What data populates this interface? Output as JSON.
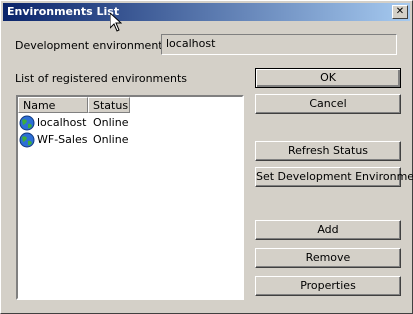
{
  "window": {
    "title": "Environments List",
    "close_glyph": "✕"
  },
  "dev_env": {
    "label": "Development environment:",
    "value": "localhost"
  },
  "list": {
    "label": "List of registered environments",
    "columns": [
      "Name",
      "Status"
    ],
    "rows": [
      {
        "name": "localhost",
        "status": "Online",
        "icon": "globe-icon"
      },
      {
        "name": "WF-Sales",
        "status": "Online",
        "icon": "globe-icon"
      }
    ]
  },
  "buttons": {
    "ok": "OK",
    "cancel": "Cancel",
    "refresh": "Refresh Status",
    "set_dev": "Set Development Environment",
    "add": "Add",
    "remove": "Remove",
    "properties": "Properties"
  }
}
